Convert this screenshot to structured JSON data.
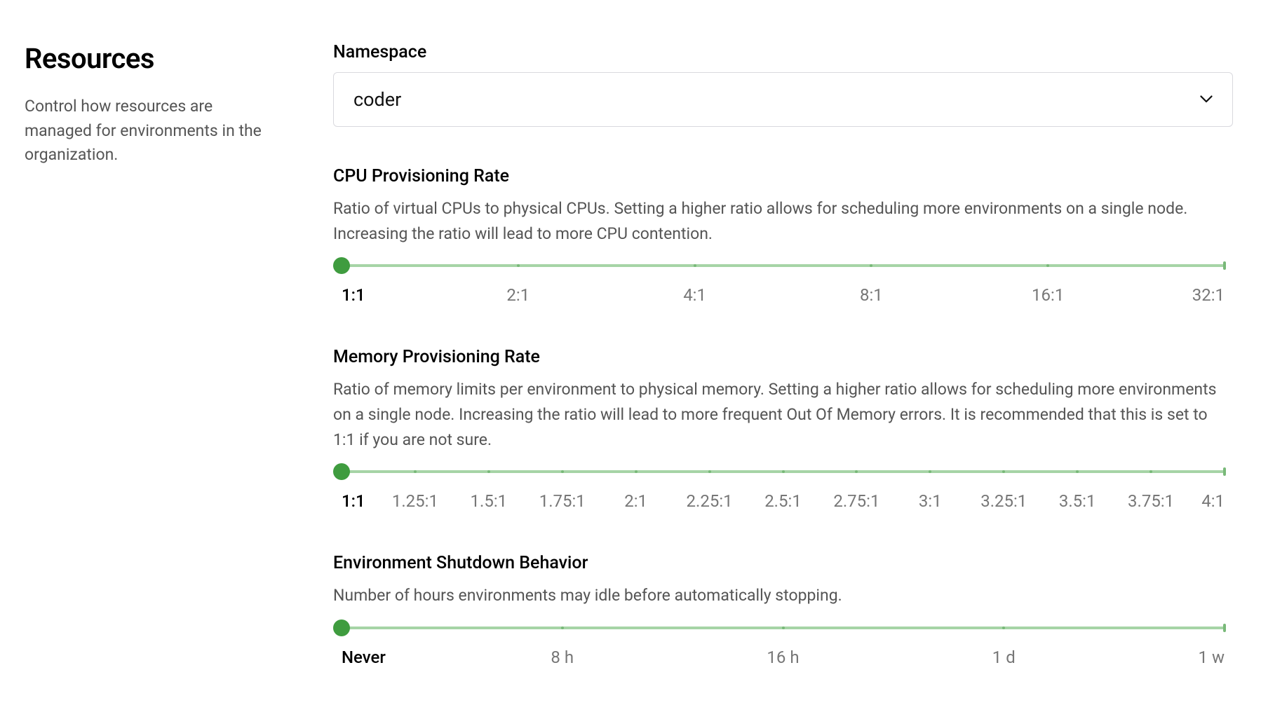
{
  "sidebar": {
    "title": "Resources",
    "description": "Control how resources are managed for environments in the organization."
  },
  "namespace": {
    "label": "Namespace",
    "value": "coder"
  },
  "cpu": {
    "label": "CPU Provisioning Rate",
    "description": "Ratio of virtual CPUs to physical CPUs. Setting a higher ratio allows for scheduling more environments on a single node. Increasing the ratio will lead to more CPU contention.",
    "options": [
      "1:1",
      "2:1",
      "4:1",
      "8:1",
      "16:1",
      "32:1"
    ],
    "selected_index": 0
  },
  "memory": {
    "label": "Memory Provisioning Rate",
    "description": "Ratio of memory limits per environment to physical memory. Setting a higher ratio allows for scheduling more environments on a single node. Increasing the ratio will lead to more frequent Out Of Memory errors. It is recommended that this is set to 1:1 if you are not sure.",
    "options": [
      "1:1",
      "1.25:1",
      "1.5:1",
      "1.75:1",
      "2:1",
      "2.25:1",
      "2.5:1",
      "2.75:1",
      "3:1",
      "3.25:1",
      "3.5:1",
      "3.75:1",
      "4:1"
    ],
    "selected_index": 0
  },
  "shutdown": {
    "label": "Environment Shutdown Behavior",
    "description": "Number of hours environments may idle before automatically stopping.",
    "options": [
      "Never",
      "8 h",
      "16 h",
      "1 d",
      "1 w"
    ],
    "selected_index": 0
  }
}
